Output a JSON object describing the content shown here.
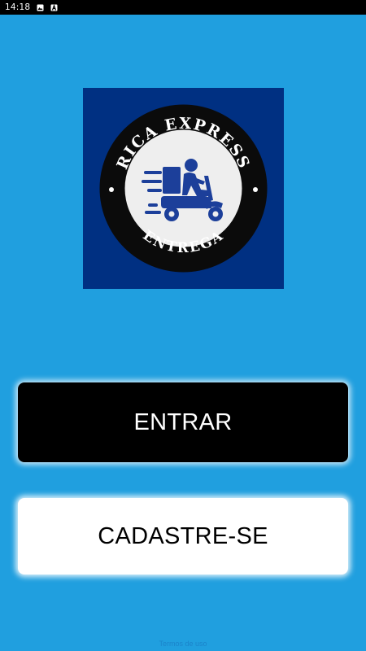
{
  "status_bar": {
    "time": "14:18",
    "icons": [
      "image-icon",
      "text-a-icon"
    ]
  },
  "logo": {
    "top_text": "RICA EXPRESS",
    "bottom_text": "ENTREGA",
    "icon": "delivery-scooter-icon",
    "background_color": "#003082"
  },
  "buttons": {
    "enter_label": "ENTRAR",
    "register_label": "CADASTRE-SE"
  },
  "footer": {
    "terms_link": "Termos de uso"
  },
  "colors": {
    "background": "#209FDF",
    "enter_button": "#000000",
    "register_button": "#FFFFFF",
    "logo_blue": "#003082"
  }
}
